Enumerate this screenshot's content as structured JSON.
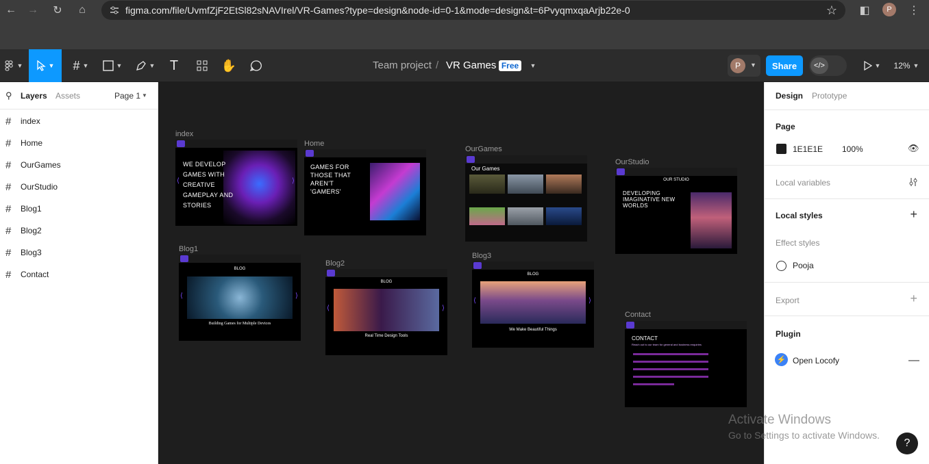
{
  "browser": {
    "url": "figma.com/file/UvmfZjF2EtSl82sNAVIrel/VR-Games?type=design&node-id=0-1&mode=design&t=6PvyqmxqaArjb22e-0",
    "profile_initial": "P"
  },
  "toolbar": {
    "breadcrumb_team": "Team project",
    "separator": "/",
    "file_name": "VR Games",
    "plan_badge": "Free",
    "user_initial": "P",
    "share_label": "Share",
    "zoom": "12%"
  },
  "left_panel": {
    "tabs": [
      "Layers",
      "Assets"
    ],
    "page_selector": "Page 1",
    "layers": [
      "index",
      "Home",
      "OurGames",
      "OurStudio",
      "Blog1",
      "Blog2",
      "Blog3",
      "Contact"
    ]
  },
  "canvas": {
    "frames": {
      "index": {
        "label": "index",
        "hero": "WE DEVELOP GAMES WITH CREATIVE GAMEPLAY AND STORIES"
      },
      "home": {
        "label": "Home",
        "hero": "GAMES FOR THOSE THAT AREN'T 'GAMERS'"
      },
      "ourgames": {
        "label": "OurGames",
        "heading": "Our Games"
      },
      "ourstudio": {
        "label": "OurStudio",
        "heading": "OUR STUDIO",
        "hero": "DEVELOPING IMAGINATIVE NEW WORLDS"
      },
      "blog1": {
        "label": "Blog1",
        "heading": "BLOG",
        "caption": "Building Games for Multiple Devices"
      },
      "blog2": {
        "label": "Blog2",
        "heading": "BLOG",
        "caption": "Real Time Design Tools"
      },
      "blog3": {
        "label": "Blog3",
        "heading": "BLOG",
        "caption": "We Make Beautiful Things"
      },
      "contact": {
        "label": "Contact",
        "heading": "CONTACT",
        "subheading": "Reach out to our team for general and business enquiries"
      }
    }
  },
  "right_panel": {
    "tabs": [
      "Design",
      "Prototype"
    ],
    "page_title": "Page",
    "page_color": "1E1E1E",
    "page_opacity": "100%",
    "local_variables": "Local variables",
    "local_styles": "Local styles",
    "effect_styles": "Effect styles",
    "effect_style_name": "Pooja",
    "export": "Export",
    "plugin": "Plugin",
    "plugin_name": "Open Locofy"
  },
  "os": {
    "watermark_title": "Activate Windows",
    "watermark_sub": "Go to Settings to activate Windows.",
    "help": "?"
  },
  "colors": {
    "accent": "#0d99ff",
    "canvas_bg": "#1e1e1e",
    "page_swatch": "#1E1E1E"
  }
}
